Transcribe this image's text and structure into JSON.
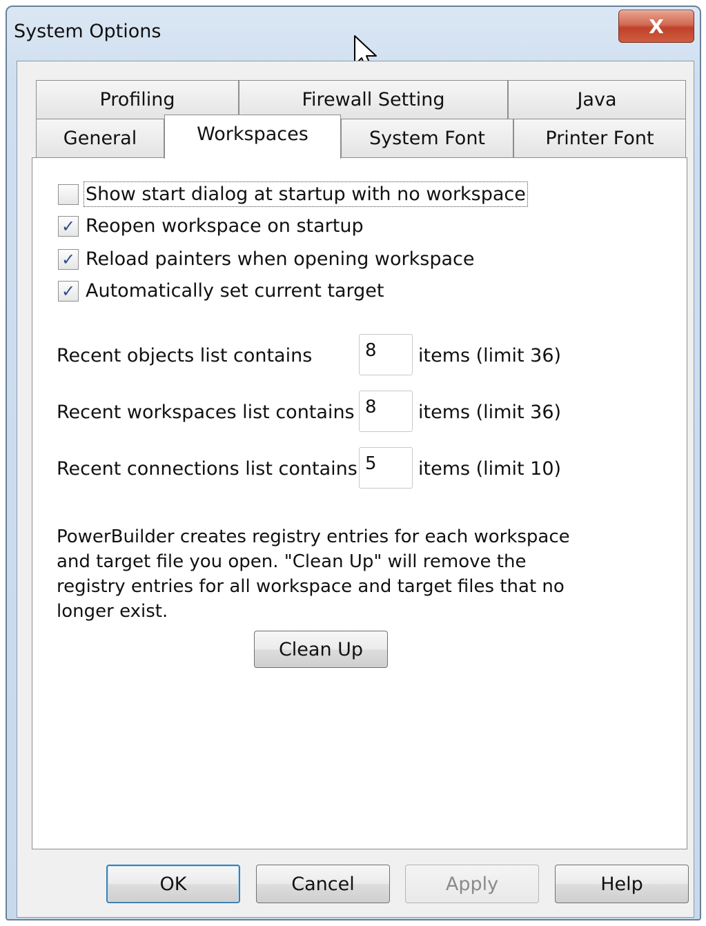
{
  "window": {
    "title": "System Options",
    "close_label": "X"
  },
  "tabs_row1": [
    {
      "label": "Profiling"
    },
    {
      "label": "Firewall Setting"
    },
    {
      "label": "Java"
    }
  ],
  "tabs_row2": [
    {
      "label": "General"
    },
    {
      "label": "Workspaces",
      "active": true
    },
    {
      "label": "System Font"
    },
    {
      "label": "Printer Font"
    }
  ],
  "checkboxes": [
    {
      "label": "Show start dialog at startup with no workspace",
      "checked": false
    },
    {
      "label": "Reopen workspace on startup",
      "checked": true
    },
    {
      "label": "Reload painters when opening workspace",
      "checked": true
    },
    {
      "label": "Automatically set current target",
      "checked": true
    }
  ],
  "recent_lists": [
    {
      "label": "Recent objects list contains",
      "value": "8",
      "suffix": "items (limit 36)"
    },
    {
      "label": "Recent workspaces list contains",
      "value": "8",
      "suffix": "items (limit 36)"
    },
    {
      "label": "Recent connections list contains",
      "value": "5",
      "suffix": "items (limit 10)"
    }
  ],
  "info_text": "PowerBuilder creates registry entries for each workspace and target file you open. \"Clean Up\" will remove the registry entries for all workspace and target files that no longer exist.",
  "cleanup_label": "Clean Up",
  "buttons": {
    "ok": "OK",
    "cancel": "Cancel",
    "apply": "Apply",
    "help": "Help"
  }
}
